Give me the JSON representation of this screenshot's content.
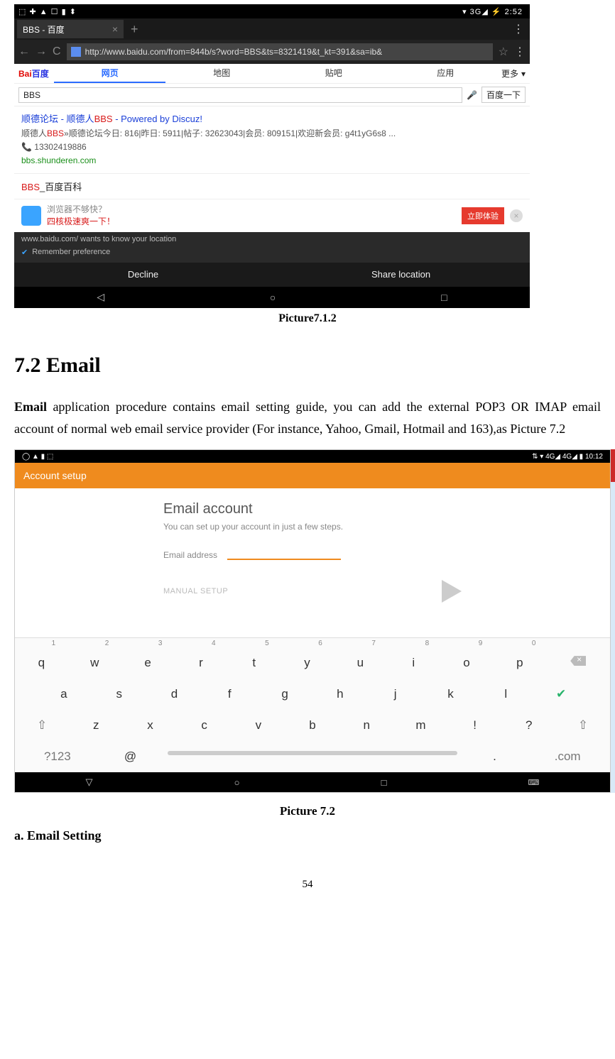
{
  "ss1": {
    "status_left": "⬚ ✚ ▲ ☐ ▮ ⬍",
    "status_right": "▾ 3G◢ ⚡ 2:52",
    "tab_title": "BBS - 百度",
    "url": "http://www.baidu.com/from=844b/s?word=BBS&ts=8321419&t_kt=391&sa=ib&",
    "logo_a": "Bai",
    "logo_b": "百度",
    "tabs": [
      "网页",
      "地图",
      "贴吧",
      "应用",
      "更多"
    ],
    "search_value": "BBS",
    "search_btn": "百度一下",
    "r1_title_a": "顺德论坛 - 顺德人",
    "r1_title_hl": "BBS",
    "r1_title_b": " - Powered by Discuz!",
    "r1_desc_a": "顺德人",
    "r1_desc_hl": "BBS",
    "r1_desc_b": "»顺德论坛今日: 816|昨日: 5911|帖子: 32623043|会员: 809151|欢迎新会员: g4t1yG6s8 ...",
    "r1_phone": "📞 13302419886",
    "r1_site": "bbs.shunderen.com",
    "r2_a": "BBS",
    "r2_b": "_百度百科",
    "promo1": "浏览器不够快？",
    "promo2": "四核极速爽一下！",
    "promo_btn": "立即体验",
    "geo": "www.baidu.com/ wants to know your location",
    "remember": "Remember preference",
    "decline": "Decline",
    "share": "Share location"
  },
  "caption1": "Picture7.1.2",
  "section_heading": "7.2 Email",
  "para_lead": "Email",
  "para_rest": " application procedure contains email setting guide, you can add the external POP3 OR IMAP email account of normal web email service provider (For instance, Yahoo, Gmail, Hotmail and 163),as Picture 7.2",
  "ss2": {
    "status_left": "◯ ▲ ▮ ⬚",
    "status_right": "⇅ ▾ 4G◢ 4G◢ ▮ 10:12",
    "appbar": "Account setup",
    "title": "Email account",
    "subtitle": "You can set up your account in just a few steps.",
    "field_label": "Email address",
    "manual": "MANUAL SETUP",
    "row_nums": [
      "1",
      "2",
      "3",
      "4",
      "5",
      "6",
      "7",
      "8",
      "9",
      "0"
    ],
    "row1": [
      "q",
      "w",
      "e",
      "r",
      "t",
      "y",
      "u",
      "i",
      "o",
      "p"
    ],
    "row2": [
      "a",
      "s",
      "d",
      "f",
      "g",
      "h",
      "j",
      "k",
      "l"
    ],
    "row3": [
      "z",
      "x",
      "c",
      "v",
      "b",
      "n",
      "m",
      "!",
      "?"
    ],
    "k_sym": "?123",
    "k_at": "@",
    "k_dot": ".",
    "k_com": ".com"
  },
  "caption2": "Picture 7.2",
  "subheading": "a. Email Setting",
  "page_number": "54"
}
